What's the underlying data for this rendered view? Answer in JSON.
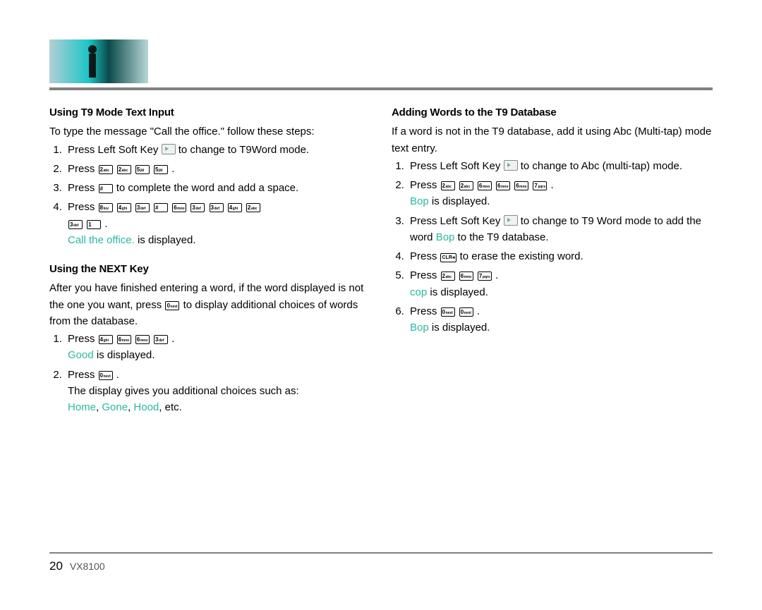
{
  "left": {
    "h1": "Using T9 Mode Text Input",
    "intro": "To type the message \"Call the office.\" follow these steps:",
    "s1a": "Press Left Soft Key ",
    "s1b": " to change to T9Word mode.",
    "s2": "Press ",
    "s3a": "Press ",
    "s3b": " to complete the word and add a space.",
    "s4": "Press ",
    "disp1a": "Call the office.",
    "disp1b": " is displayed.",
    "h2": "Using the NEXT Key",
    "p2a": "After you have finished entering a word, if the word displayed is not the one you want, press ",
    "p2b": " to display additional choices of words from the database.",
    "n1": "Press ",
    "good": "Good",
    "n1b": " is displayed.",
    "n2a": "Press ",
    "n2b": "The display gives you additional choices such as:",
    "home": "Home",
    "gone": "Gone",
    "hood": "Hood",
    "etc": ", etc."
  },
  "right": {
    "h1": "Adding Words to the T9 Database",
    "intro": "If a word is not in the T9 database, add it using Abc (Multi-tap) mode text entry.",
    "r1a": "Press Left Soft Key ",
    "r1b": " to change to Abc (multi-tap) mode.",
    "r2": "Press ",
    "bop": "Bop",
    "isdisp": " is displayed.",
    "r3a": "Press Left Soft Key ",
    "r3b": " to change to T9 Word mode to add the word ",
    "r3c": " to the T9 database.",
    "r4a": "Press ",
    "r4b": " to erase the existing word.",
    "r5": "Press ",
    "cop": "cop",
    "r6": "Press "
  },
  "keys": {
    "k1": "1",
    "k1s": "",
    "k2": "2",
    "k2s": "abc",
    "k3": "3",
    "k3s": "def",
    "k4": "4",
    "k4s": "ghi",
    "k5": "5",
    "k5s": "jkl",
    "k6": "6",
    "k6s": "mno",
    "k7": "7",
    "k7s": "pqrs",
    "k8": "8",
    "k8s": "tuv",
    "k0": "0",
    "k0s": "next",
    "hash": "#",
    "hashs": "",
    "clr": "CLR"
  },
  "footer": {
    "page": "20",
    "model": "VX8100"
  }
}
